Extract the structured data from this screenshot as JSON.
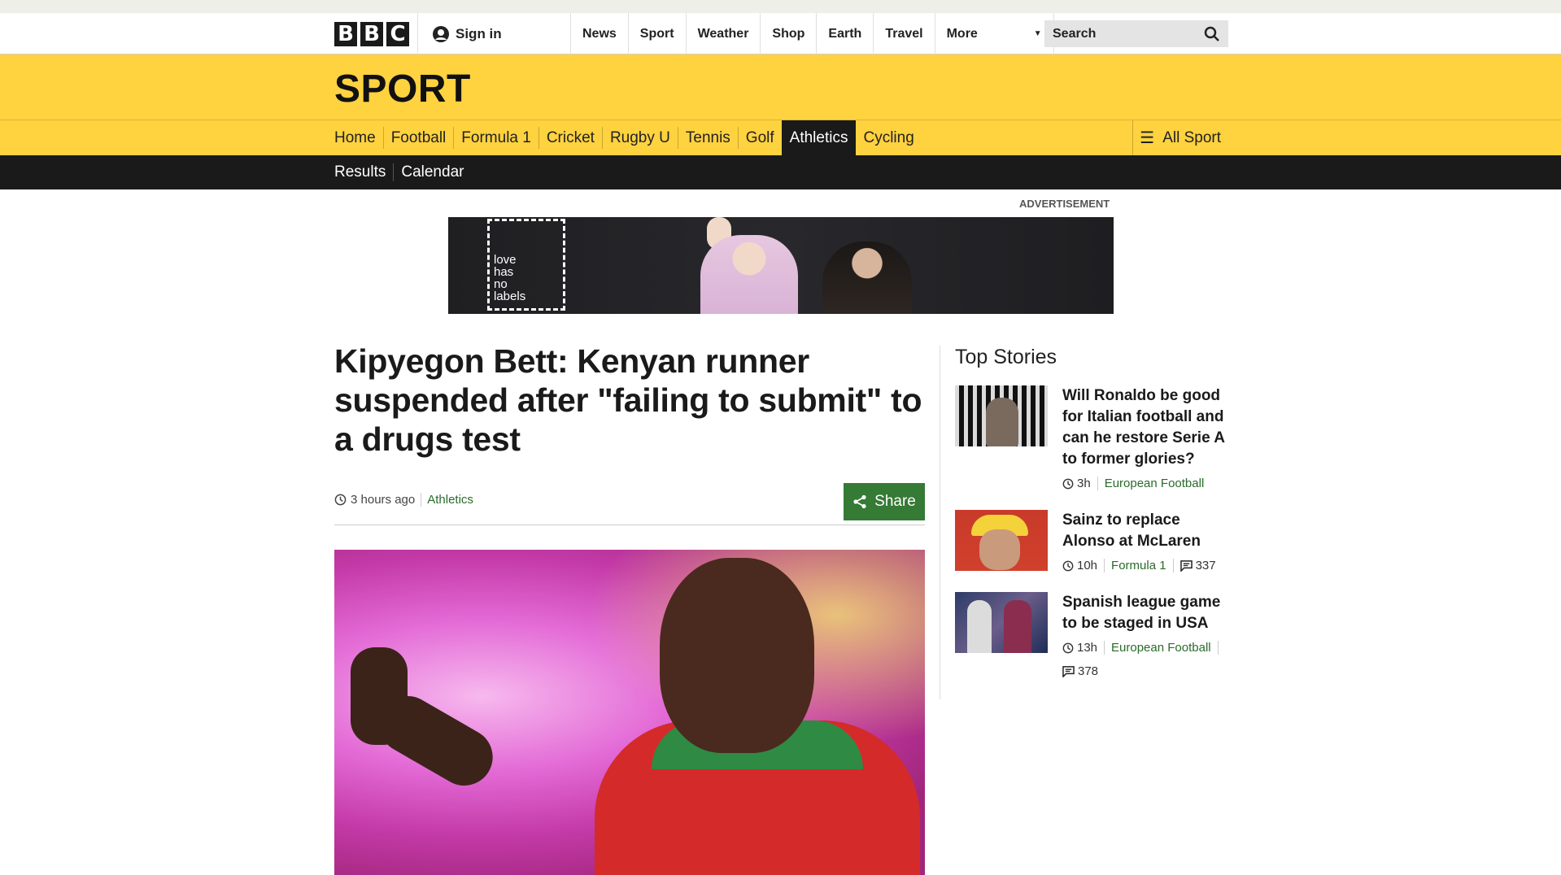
{
  "masthead": {
    "logo_letters": [
      "B",
      "B",
      "C"
    ],
    "signin_label": "Sign in",
    "nav": [
      "News",
      "Sport",
      "Weather",
      "Shop",
      "Earth",
      "Travel"
    ],
    "more_label": "More",
    "search_placeholder": "Search"
  },
  "section": {
    "title": "SPORT",
    "subnav": [
      "Home",
      "Football",
      "Formula 1",
      "Cricket",
      "Rugby U",
      "Tennis",
      "Golf",
      "Athletics",
      "Cycling"
    ],
    "active": "Athletics",
    "all_sport_label": "All Sport",
    "secondary": [
      "Results",
      "Calendar"
    ]
  },
  "advert": {
    "label": "ADVERTISEMENT",
    "text_lines": [
      "love",
      "has",
      "no",
      "labels"
    ]
  },
  "article": {
    "headline": "Kipyegon Bett: Kenyan runner suspended after \"failing to submit\" to a drugs test",
    "time": "3 hours ago",
    "section": "Athletics",
    "share_label": "Share"
  },
  "top_stories": {
    "heading": "Top Stories",
    "items": [
      {
        "title": "Will Ronaldo be good for Italian football and can he restore Serie A to former glories?",
        "time": "3h",
        "section": "European Football",
        "comments": ""
      },
      {
        "title": "Sainz to replace Alonso at McLaren",
        "time": "10h",
        "section": "Formula 1",
        "comments": "337"
      },
      {
        "title": "Spanish league game to be staged in USA",
        "time": "13h",
        "section": "European Football",
        "comments": "378"
      }
    ]
  },
  "colors": {
    "sport_yellow": "#ffd23f",
    "dark_bar": "#1a1a1a",
    "share_green": "#357a35",
    "section_green": "#2a6b2a"
  }
}
